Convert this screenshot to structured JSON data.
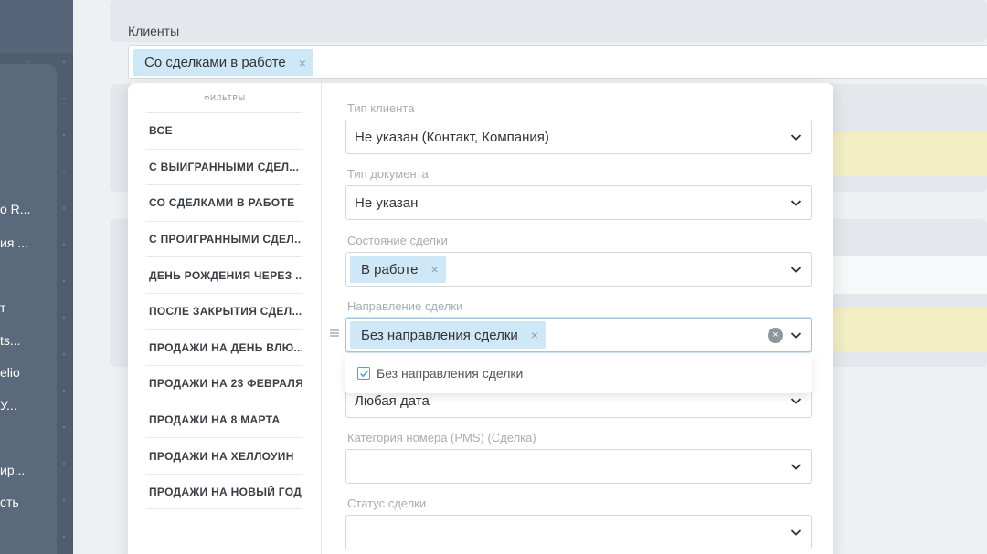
{
  "sidebar": {
    "items": [
      "o R...",
      "ия ...",
      "т",
      "ts...",
      "elio",
      "У...",
      "ир...",
      "сть"
    ]
  },
  "clients": {
    "label": "Клиенты",
    "chip": "Со сделками в работе",
    "chip_remove": "×"
  },
  "filters": {
    "title": "ФИЛЬТРЫ",
    "items": [
      "ВСЕ",
      "С ВЫИГРАННЫМИ СДЕЛ...",
      "СО СДЕЛКАМИ В РАБОТЕ",
      "С ПРОИГРАННЫМИ СДЕЛ...",
      "ДЕНЬ РОЖДЕНИЯ ЧЕРЕЗ ...",
      "ПОСЛЕ ЗАКРЫТИЯ СДЕЛ...",
      "ПРОДАЖИ НА ДЕНЬ ВЛЮ...",
      "ПРОДАЖИ НА 23 ФЕВРАЛЯ",
      "ПРОДАЖИ НА 8 МАРТА",
      "ПРОДАЖИ НА ХЕЛЛОУИН",
      "ПРОДАЖИ НА НОВЫЙ ГОД"
    ]
  },
  "fields": {
    "client_type": {
      "label": "Тип клиента",
      "value": "Не указан (Контакт, Компания)"
    },
    "doc_type": {
      "label": "Тип документа",
      "value": "Не указан"
    },
    "deal_state": {
      "label": "Состояние сделки",
      "chip": "В работе",
      "chip_remove": "×"
    },
    "deal_direction": {
      "label": "Направление сделки",
      "chip": "Без направления сделки",
      "chip_remove": "×",
      "clear": "×"
    },
    "date": {
      "value": "Любая дата"
    },
    "room_category": {
      "label": "Категория номера (PMS) (Сделка)",
      "value": ""
    },
    "deal_status": {
      "label": "Статус сделки",
      "value": ""
    }
  },
  "dropdown_option": {
    "label": "Без направления сделки",
    "checked": true
  },
  "colors": {
    "chip_bg": "#cfe8f7",
    "accent": "#4a9fd8",
    "sidebar": "#4f5e6e",
    "highlight_row": "#f3efc4"
  }
}
